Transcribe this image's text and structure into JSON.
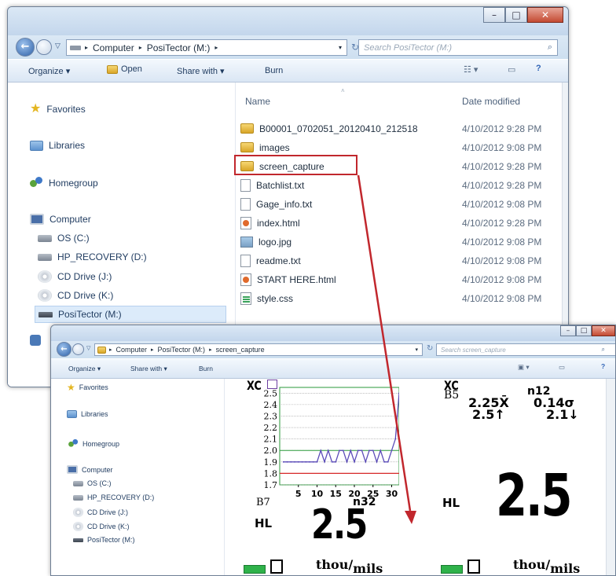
{
  "explorer_main": {
    "breadcrumb": [
      "Computer",
      "PosiTector (M:)"
    ],
    "search_placeholder": "Search PosiTector (M:)",
    "toolbar": {
      "organize": "Organize",
      "open": "Open",
      "share": "Share with",
      "burn": "Burn"
    },
    "nav": {
      "favorites": "Favorites",
      "libraries": "Libraries",
      "homegroup": "Homegroup",
      "computer": "Computer",
      "drives": [
        "OS (C:)",
        "HP_RECOVERY (D:)",
        "CD Drive (J:)",
        "CD Drive (K:)",
        "PosiTector (M:)"
      ]
    },
    "columns": {
      "name": "Name",
      "date": "Date modified"
    },
    "files": [
      {
        "name": "B00001_0702051_20120410_212518",
        "date": "4/10/2012 9:28 PM",
        "icon": "folder-icon"
      },
      {
        "name": "images",
        "date": "4/10/2012 9:08 PM",
        "icon": "folder-icon"
      },
      {
        "name": "screen_capture",
        "date": "4/10/2012 9:28 PM",
        "icon": "folder-icon"
      },
      {
        "name": "Batchlist.txt",
        "date": "4/10/2012 9:28 PM",
        "icon": "text-file-icon"
      },
      {
        "name": "Gage_info.txt",
        "date": "4/10/2012 9:08 PM",
        "icon": "text-file-icon"
      },
      {
        "name": "index.html",
        "date": "4/10/2012 9:28 PM",
        "icon": "html-file-icon"
      },
      {
        "name": "logo.jpg",
        "date": "4/10/2012 9:08 PM",
        "icon": "image-file-icon"
      },
      {
        "name": "readme.txt",
        "date": "4/10/2012 9:08 PM",
        "icon": "text-file-icon"
      },
      {
        "name": "START HERE.html",
        "date": "4/10/2012 9:08 PM",
        "icon": "html-file-icon"
      },
      {
        "name": "style.css",
        "date": "4/10/2012 9:08 PM",
        "icon": "css-file-icon"
      }
    ]
  },
  "explorer_capture": {
    "breadcrumb": [
      "Computer",
      "PosiTector (M:)",
      "screen_capture"
    ],
    "search_placeholder": "Search screen_capture",
    "toolbar": {
      "organize": "Organize",
      "share": "Share with",
      "burn": "Burn"
    },
    "nav": {
      "favorites": "Favorites",
      "libraries": "Libraries",
      "homegroup": "Homegroup",
      "computer": "Computer",
      "drives": [
        "OS (C:)",
        "HP_RECOVERY (D:)",
        "CD Drive (J:)",
        "CD Drive (K:)",
        "PosiTector (M:)"
      ]
    },
    "thumb_graph": {
      "mode": "XC",
      "batch": "B7",
      "count": "n32",
      "hl": "HL",
      "reading": "2.5",
      "units_a": "thou/",
      "units_b": "mils",
      "y_ticks": [
        "2.5",
        "2.4",
        "2.3",
        "2.2",
        "2.1",
        "2.0",
        "1.9",
        "1.8",
        "1.7"
      ],
      "x_ticks": [
        "5",
        "10",
        "15",
        "20",
        "25",
        "30"
      ]
    },
    "thumb_stats": {
      "mode": "XC",
      "batch": "B5",
      "count": "n12",
      "mean": "2.25",
      "mean_sym": "X̄",
      "max": "2.5",
      "sd": "0.14",
      "sd_sym": "σ",
      "min": "2.1",
      "hl": "HL",
      "reading": "2.5",
      "units_a": "thou/",
      "units_b": "mils"
    }
  },
  "chart_data": {
    "type": "line",
    "title": "",
    "xlabel": "",
    "ylabel": "",
    "ylim": [
      1.7,
      2.55
    ],
    "xlim": [
      0,
      32
    ],
    "x": [
      1,
      2,
      3,
      4,
      5,
      6,
      7,
      8,
      9,
      10,
      11,
      12,
      13,
      14,
      15,
      16,
      17,
      18,
      19,
      20,
      21,
      22,
      23,
      24,
      25,
      26,
      27,
      28,
      29,
      30,
      31,
      32
    ],
    "series": [
      {
        "values": [
          1.9,
          1.9,
          1.9,
          1.9,
          1.9,
          1.9,
          1.9,
          1.9,
          1.9,
          1.9,
          2.0,
          1.9,
          2.0,
          1.9,
          1.9,
          2.0,
          2.0,
          1.9,
          2.0,
          1.9,
          2.0,
          2.0,
          1.9,
          2.0,
          2.0,
          1.9,
          2.0,
          1.9,
          1.9,
          2.0,
          2.1,
          2.5
        ]
      }
    ],
    "limit_high": 2.0,
    "limit_low": 1.8,
    "grid": true
  }
}
